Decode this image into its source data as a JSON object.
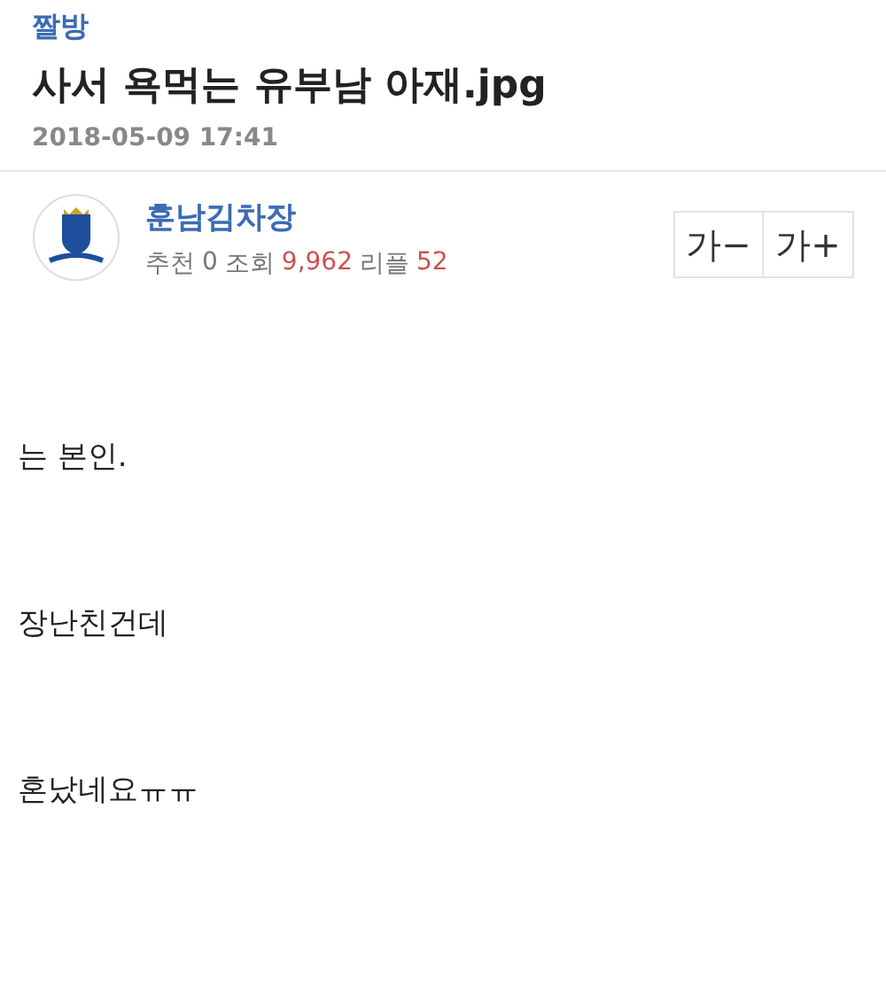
{
  "board": "짤방",
  "title": "사서 욕먹는 유부남 아재.jpg",
  "date": "2018-05-09 17:41",
  "author": {
    "name": "훈남김차장"
  },
  "stats": [
    {
      "label": "추천",
      "value": "0",
      "highlighted": false
    },
    {
      "label": "조회",
      "value": "9,962",
      "highlighted": true
    },
    {
      "label": "리플",
      "value": "52",
      "highlighted": true
    }
  ],
  "font_buttons": [
    "가−",
    "가+"
  ],
  "body": [
    "는 본인.",
    "장난친건데",
    "혼났네요ㅠㅠ"
  ]
}
